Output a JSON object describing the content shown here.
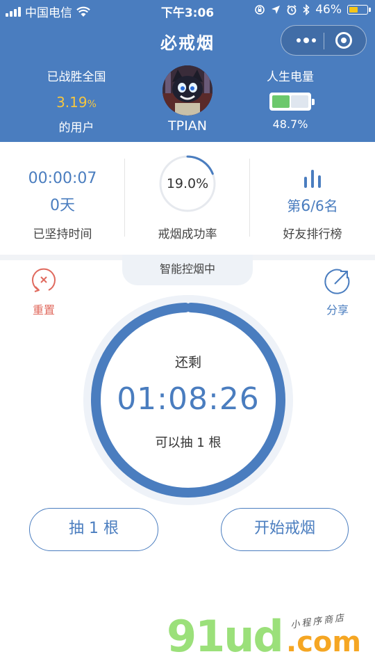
{
  "status_bar": {
    "carrier": "中国电信",
    "time": "下午3:06",
    "battery": "46%",
    "icons": [
      "signal-icon",
      "wifi-icon",
      "lock-rotation-icon",
      "location-icon",
      "alarm-icon",
      "bluetooth-icon",
      "battery-icon"
    ]
  },
  "header": {
    "title": "必戒烟",
    "beat_label": "已战胜全国",
    "beat_value": "3.19",
    "beat_unit": "%",
    "beat_sub": "的用户",
    "username": "TPIAN",
    "energy_label": "人生电量",
    "energy_value": "48.7%",
    "energy_fraction": 0.487,
    "colors": {
      "header_bg": "#4a7dbf",
      "accent_yellow": "#f5c640",
      "battery_green": "#6cc86c"
    }
  },
  "stats": {
    "elapsed_time": "00:00:07",
    "days": "0天",
    "elapsed_label": "已坚持时间",
    "success_rate": "19.0%",
    "success_fraction": 0.19,
    "success_label": "戒烟成功率",
    "rank_prefix": "第",
    "rank_value": "6",
    "rank_total": "/6名",
    "rank_label": "好友排行榜"
  },
  "control": {
    "mode_tab": "智能控烟中",
    "reset_label": "重置",
    "share_label": "分享",
    "remain_label": "还剩",
    "remain_time": "01:08:26",
    "allow_text": "可以抽 1 根",
    "smoke_button": "抽 1 根",
    "quit_button": "开始戒烟",
    "colors": {
      "primary": "#4a7dbf",
      "reset": "#e06a5e"
    }
  },
  "watermark": {
    "main": "91ud",
    "suffix": ".com",
    "tagline": "小程序商店"
  }
}
